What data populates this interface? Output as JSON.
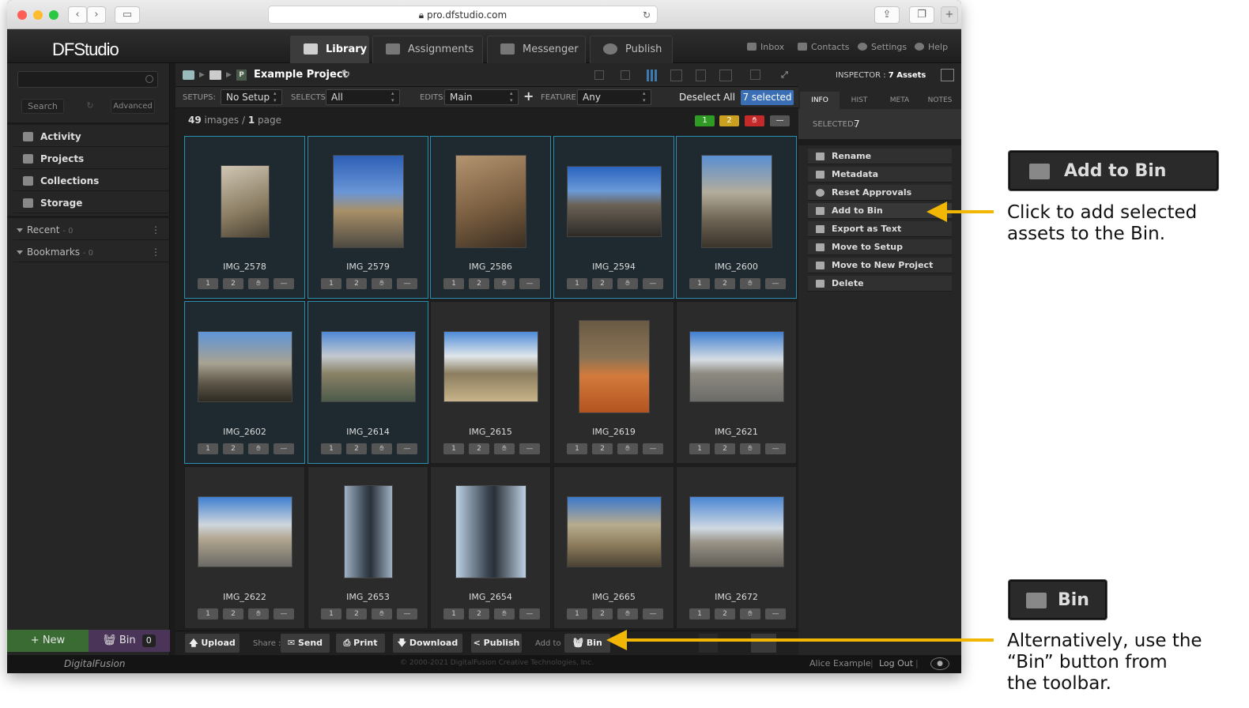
{
  "browser": {
    "url": "pro.dfstudio.com"
  },
  "header": {
    "logo": "DFStudio",
    "tabs": [
      {
        "label": "Library"
      },
      {
        "label": "Assignments"
      },
      {
        "label": "Messenger"
      },
      {
        "label": "Publish"
      }
    ],
    "links": {
      "inbox": "Inbox",
      "contacts": "Contacts",
      "settings": "Settings",
      "help": "Help"
    }
  },
  "sidebar": {
    "search_btn": "Search",
    "advanced_btn": "Advanced",
    "items": [
      "Activity",
      "Projects",
      "Collections",
      "Storage"
    ],
    "recent": {
      "label": "Recent",
      "count": "- 0"
    },
    "bookmarks": {
      "label": "Bookmarks",
      "count": "- 0"
    },
    "new_btn": "+ New",
    "bin_btn": "Bin",
    "bin_count": "0"
  },
  "main": {
    "project_title": "Example Project",
    "filters": {
      "setups_label": "SETUPS:",
      "setups_value": "No Setup",
      "selects_label": "SELECTS:",
      "selects_value": "All",
      "edits_label": "EDITS:",
      "edits_value": "Main",
      "feature_label": "FEATURE:",
      "feature_value": "Any",
      "deselect": "Deselect All",
      "selected": "7 selected"
    },
    "count": {
      "images": "49",
      "images_word": "images /",
      "pages": "1",
      "pages_word": "page"
    },
    "flags": [
      "1",
      "2"
    ],
    "rating_buttons": [
      "1",
      "2",
      "—"
    ],
    "images": [
      {
        "name": "IMG_2578",
        "selected": true
      },
      {
        "name": "IMG_2579",
        "selected": true
      },
      {
        "name": "IMG_2586",
        "selected": true
      },
      {
        "name": "IMG_2594",
        "selected": true
      },
      {
        "name": "IMG_2600",
        "selected": true
      },
      {
        "name": "IMG_2602",
        "selected": true
      },
      {
        "name": "IMG_2614",
        "selected": true
      },
      {
        "name": "IMG_2615",
        "selected": false
      },
      {
        "name": "IMG_2619",
        "selected": false
      },
      {
        "name": "IMG_2621",
        "selected": false
      },
      {
        "name": "IMG_2622",
        "selected": false
      },
      {
        "name": "IMG_2653",
        "selected": false
      },
      {
        "name": "IMG_2654",
        "selected": false
      },
      {
        "name": "IMG_2665",
        "selected": false
      },
      {
        "name": "IMG_2672",
        "selected": false
      }
    ],
    "toolbar": {
      "upload": "Upload",
      "share_label": "Share :",
      "send": "Send",
      "print": "Print",
      "download": "Download",
      "publish": "Publish",
      "addto_label": "Add to :",
      "bin": "Bin"
    }
  },
  "inspector": {
    "title_prefix": "INSPECTOR :",
    "title_value": "7 Assets",
    "tabs": [
      "INFO",
      "HIST",
      "META",
      "NOTES"
    ],
    "selected_label": "SELECTED:",
    "selected_value": "7",
    "actions": [
      "Rename",
      "Metadata",
      "Reset Approvals",
      "Add to Bin",
      "Export as Text",
      "Move to Setup",
      "Move to New Project",
      "Delete"
    ]
  },
  "footer": {
    "brand": "DigitalFusion",
    "copyright": "© 2000-2021 DigitalFusion Creative Technologies, Inc.",
    "user": "Alice Example",
    "logout": "Log Out"
  },
  "callouts": {
    "add_to_bin_label": "Add to Bin",
    "add_to_bin_text_1": "Click to add selected",
    "add_to_bin_text_2": "assets to the Bin.",
    "bin_label": "Bin",
    "bin_text_1": "Alternatively, use the",
    "bin_text_2": "“Bin” button from",
    "bin_text_3": "the toolbar."
  },
  "colors": {
    "accent": "#2a8eb2",
    "arrow": "#f2b705",
    "new_btn": "#3a6b33",
    "bin_btn": "#4a3458",
    "selected_badge": "#3a6fb5"
  }
}
